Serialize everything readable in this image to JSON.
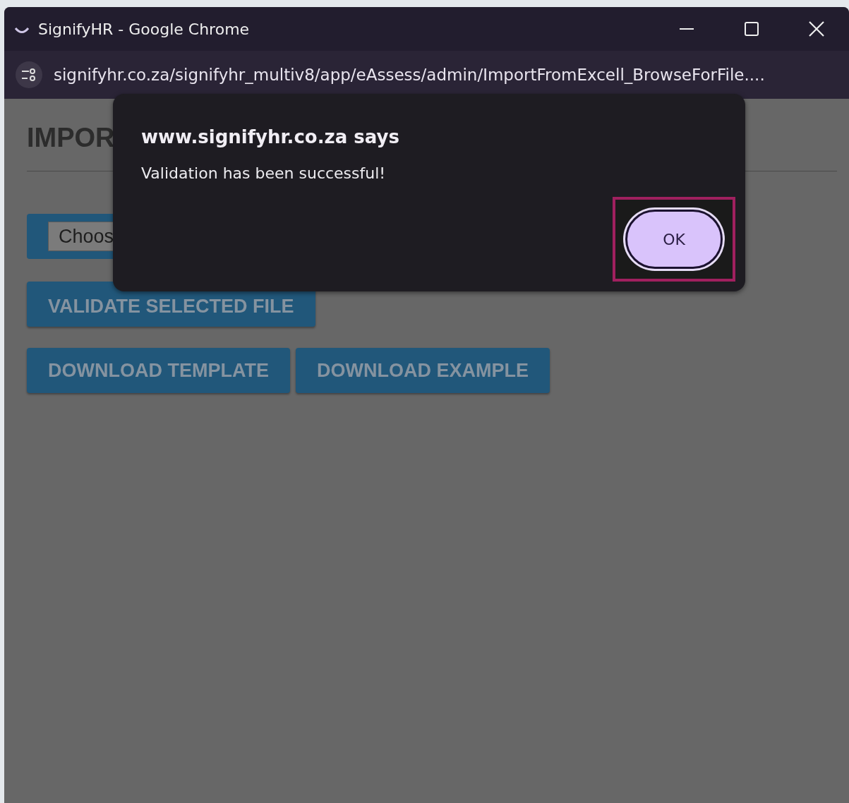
{
  "window": {
    "title": "SignifyHR - Google Chrome"
  },
  "address_bar": {
    "url": "signifyhr.co.za/signifyhr_multiv8/app/eAssess/admin/ImportFromExcell_BrowseForFile...."
  },
  "page": {
    "heading": "IMPOR",
    "file_input": {
      "label": "Choos"
    },
    "buttons": [
      "VALIDATE SELECTED FILE",
      "DOWNLOAD TEMPLATE",
      "DOWNLOAD EXAMPLE"
    ]
  },
  "dialog": {
    "title": "www.signifyhr.co.za says",
    "message": "Validation has been successful!",
    "button": {
      "label": "OK",
      "focused": true
    }
  }
}
